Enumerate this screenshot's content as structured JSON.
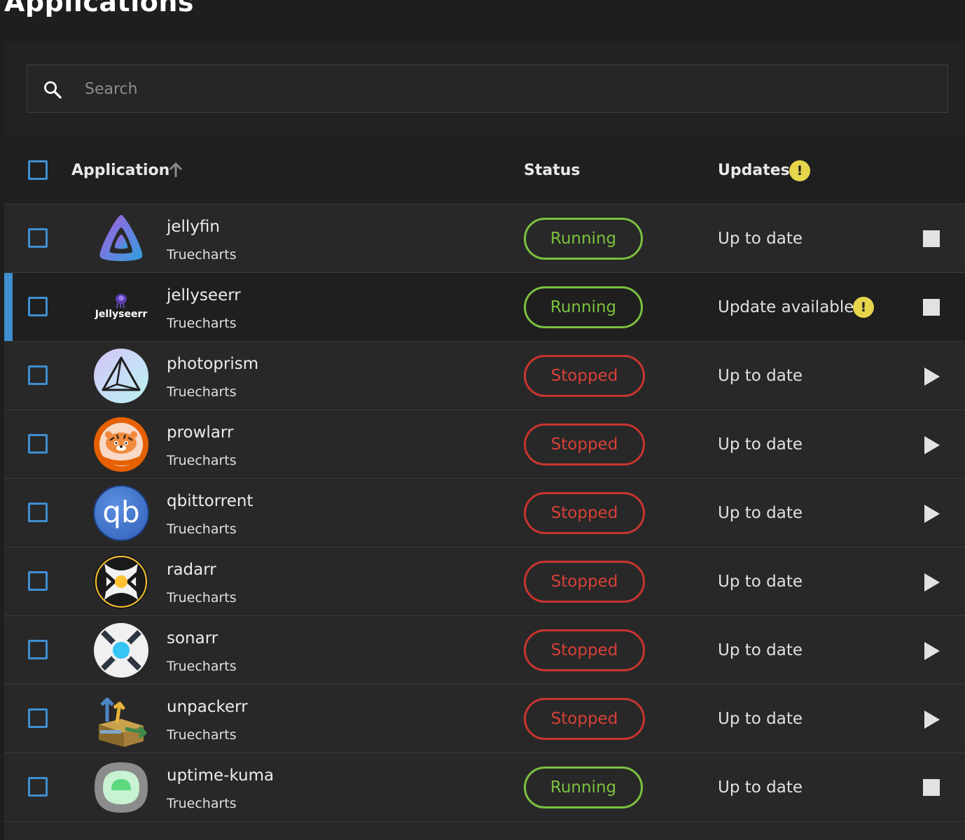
{
  "page": {
    "title": "Applications"
  },
  "search": {
    "placeholder": "Search"
  },
  "table": {
    "headers": {
      "application": "Application",
      "status": "Status",
      "updates": "Updates"
    },
    "rows": [
      {
        "name": "jellyfin",
        "catalog": "Truecharts",
        "status": "Running",
        "update": "Up to date",
        "icon": "jellyfin-icon",
        "action": "stop"
      },
      {
        "name": "jellyseerr",
        "catalog": "Truecharts",
        "status": "Running",
        "update": "Update available",
        "icon": "jellyseerr-icon",
        "icon_label": "Jellyseerr",
        "action": "stop",
        "selected": true
      },
      {
        "name": "photoprism",
        "catalog": "Truecharts",
        "status": "Stopped",
        "update": "Up to date",
        "icon": "photoprism-icon",
        "action": "start"
      },
      {
        "name": "prowlarr",
        "catalog": "Truecharts",
        "status": "Stopped",
        "update": "Up to date",
        "icon": "prowlarr-icon",
        "action": "start"
      },
      {
        "name": "qbittorrent",
        "catalog": "Truecharts",
        "status": "Stopped",
        "update": "Up to date",
        "icon": "qbittorrent-icon",
        "icon_label": "qb",
        "action": "start"
      },
      {
        "name": "radarr",
        "catalog": "Truecharts",
        "status": "Stopped",
        "update": "Up to date",
        "icon": "radarr-icon",
        "action": "start"
      },
      {
        "name": "sonarr",
        "catalog": "Truecharts",
        "status": "Stopped",
        "update": "Up to date",
        "icon": "sonarr-icon",
        "action": "start"
      },
      {
        "name": "unpackerr",
        "catalog": "Truecharts",
        "status": "Stopped",
        "update": "Up to date",
        "icon": "unpackerr-icon",
        "action": "start"
      },
      {
        "name": "uptime-kuma",
        "catalog": "Truecharts",
        "status": "Running",
        "update": "Up to date",
        "icon": "uptime-kuma-icon",
        "action": "stop"
      }
    ]
  },
  "colors": {
    "running": "#7cc03f",
    "stopped": "#d84037",
    "accent": "#3f8fd2",
    "warning": "#e6d54b"
  },
  "icons": {
    "search": "search-icon",
    "sort": "arrow-up-icon",
    "warning": "exclamation-icon",
    "stop": "stop-icon",
    "start": "play-icon"
  }
}
